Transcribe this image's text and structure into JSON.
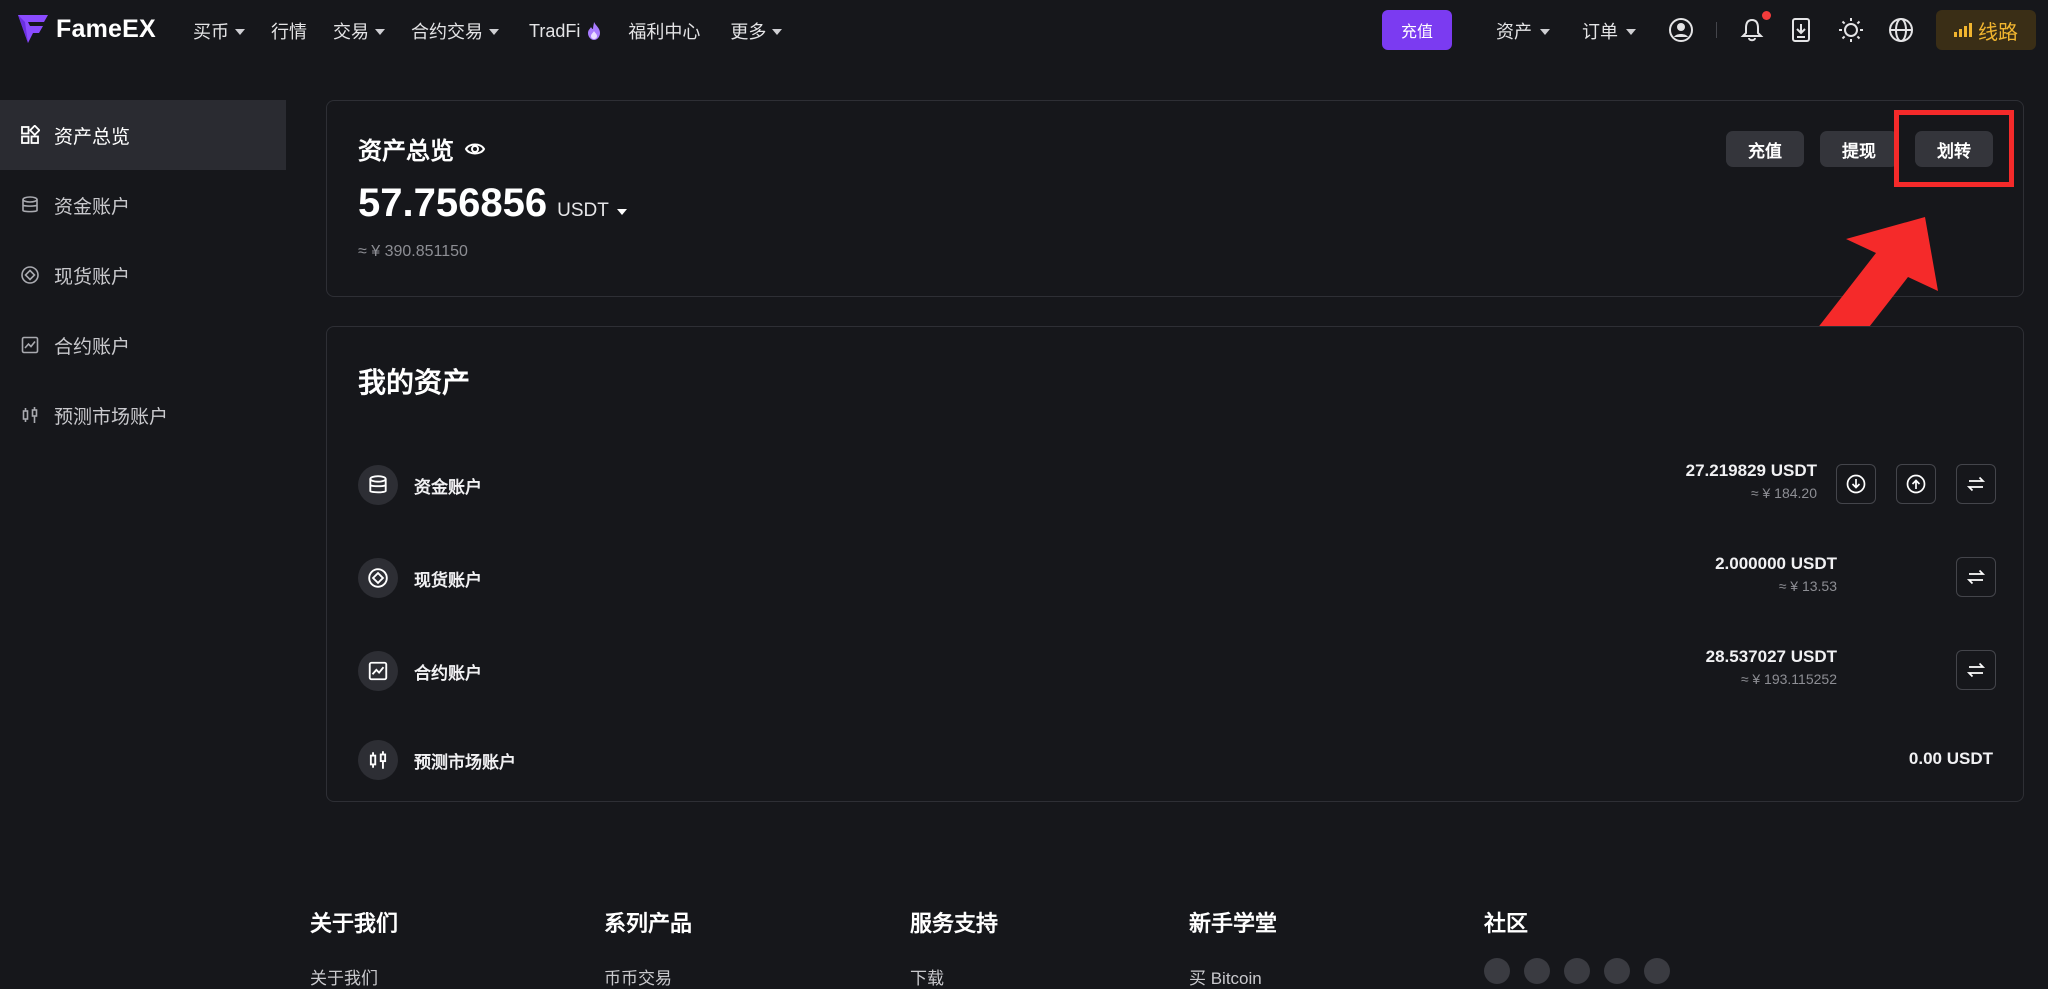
{
  "brand": {
    "name": "FameEX"
  },
  "nav": {
    "buy": "买币",
    "market": "行情",
    "trade": "交易",
    "futures": "合约交易",
    "tradfi": "TradFi",
    "rewards": "福利中心",
    "more": "更多"
  },
  "topright": {
    "deposit": "充值",
    "assets": "资产",
    "orders": "订单",
    "line": "线路"
  },
  "sidebar": {
    "items": [
      {
        "label": "资产总览",
        "icon": "grid-icon",
        "active": true
      },
      {
        "label": "资金账户",
        "icon": "database-icon"
      },
      {
        "label": "现货账户",
        "icon": "target-icon"
      },
      {
        "label": "合约账户",
        "icon": "chart-icon"
      },
      {
        "label": "预测市场账户",
        "icon": "candles-icon"
      }
    ]
  },
  "overview": {
    "title": "资产总览",
    "amount": "57.756856",
    "unit": "USDT",
    "cny": "≈ ¥ 390.851150",
    "buttons": {
      "deposit": "充值",
      "withdraw": "提现",
      "transfer": "划转"
    }
  },
  "assets": {
    "title": "我的资产",
    "rows": [
      {
        "name": "资金账户",
        "value": "27.219829 USDT",
        "cny": "≈ ¥ 184.20"
      },
      {
        "name": "现货账户",
        "value": "2.000000 USDT",
        "cny": "≈ ¥ 13.53"
      },
      {
        "name": "合约账户",
        "value": "28.537027 USDT",
        "cny": "≈ ¥ 193.115252"
      },
      {
        "name": "预测市场账户",
        "value": "0.00 USDT",
        "cny": ""
      }
    ]
  },
  "footer": {
    "about": {
      "title": "关于我们",
      "first": "关于我们"
    },
    "products": {
      "title": "系列产品",
      "first": "币币交易"
    },
    "support": {
      "title": "服务支持",
      "first": "下载"
    },
    "academy": {
      "title": "新手学堂",
      "first": "买 Bitcoin"
    },
    "community": {
      "title": "社区"
    }
  },
  "colors": {
    "accent": "#7b3bf1",
    "highlight": "#f52a2a",
    "line_button": "#f1b52f"
  }
}
